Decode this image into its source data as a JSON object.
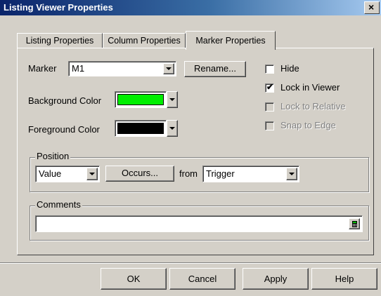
{
  "window": {
    "title": "Listing Viewer Properties",
    "close_glyph": "×"
  },
  "tabs": [
    {
      "label": "Listing Properties",
      "active": false
    },
    {
      "label": "Column Properties",
      "active": false
    },
    {
      "label": "Marker Properties",
      "active": true
    }
  ],
  "marker": {
    "label": "Marker",
    "value": "M1",
    "rename_label": "Rename..."
  },
  "colors": {
    "background_label": "Background Color",
    "background_value": "#00ee00",
    "foreground_label": "Foreground Color",
    "foreground_value": "#000000"
  },
  "options": {
    "hide": {
      "label": "Hide",
      "checked": false,
      "enabled": true
    },
    "lock_in_viewer": {
      "label": "Lock in Viewer",
      "checked": true,
      "enabled": true
    },
    "lock_to_relative": {
      "label": "Lock to Relative",
      "checked": false,
      "enabled": false
    },
    "snap_to_edge": {
      "label": "Snap to Edge",
      "checked": false,
      "enabled": false
    }
  },
  "position": {
    "legend": "Position",
    "mode_value": "Value",
    "occurs_label": "Occurs...",
    "from_label": "from",
    "from_value": "Trigger"
  },
  "comments": {
    "legend": "Comments",
    "value": ""
  },
  "buttons": {
    "ok": "OK",
    "cancel": "Cancel",
    "apply": "Apply",
    "help": "Help"
  }
}
